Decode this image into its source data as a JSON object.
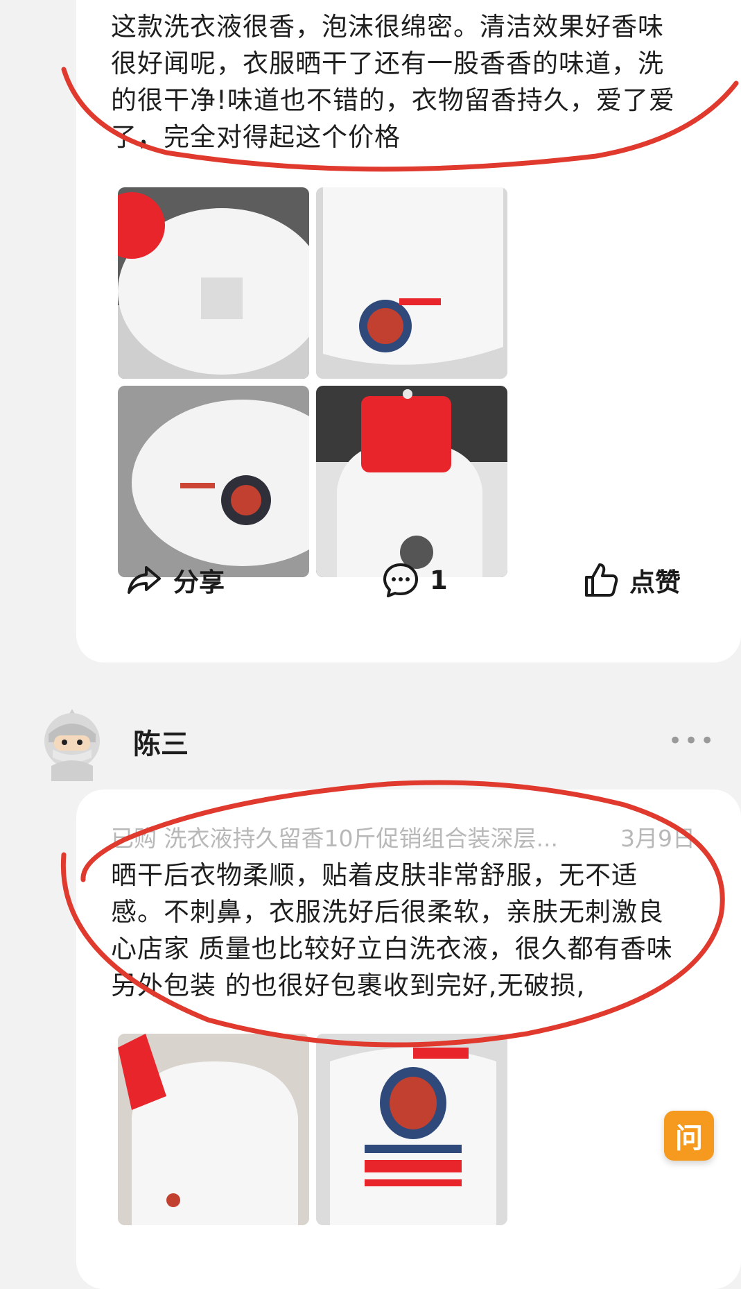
{
  "review1": {
    "text": "这款洗衣液很香，泡沫很绵密。清洁效果好香味很好闻呢，衣服晒干了还有一股香香的味道，洗的很干净!味道也不错的，衣物留香持久，爱了爱了，完全对得起这个价格"
  },
  "actions": {
    "share_label": "分享",
    "comment_count": "1",
    "like_label": "点赞"
  },
  "review2": {
    "username": "陈三",
    "more": "•••",
    "meta": "已购 洗衣液持久留香10斤促销组合装深层...",
    "date": "3月9日",
    "text": "晒干后衣物柔顺，贴着皮肤非常舒服，无不适感。不刺鼻，衣服洗好后很柔软，亲肤无刺激良心店家 质量也比较好立白洗衣液，很久都有香味 另外包装 的也很好包裹收到完好,无破损,"
  },
  "ask_button": "问",
  "colors": {
    "annotation": "#e03a2f",
    "bottle_cap": "#e8252b",
    "ask": "#f59a1e"
  }
}
